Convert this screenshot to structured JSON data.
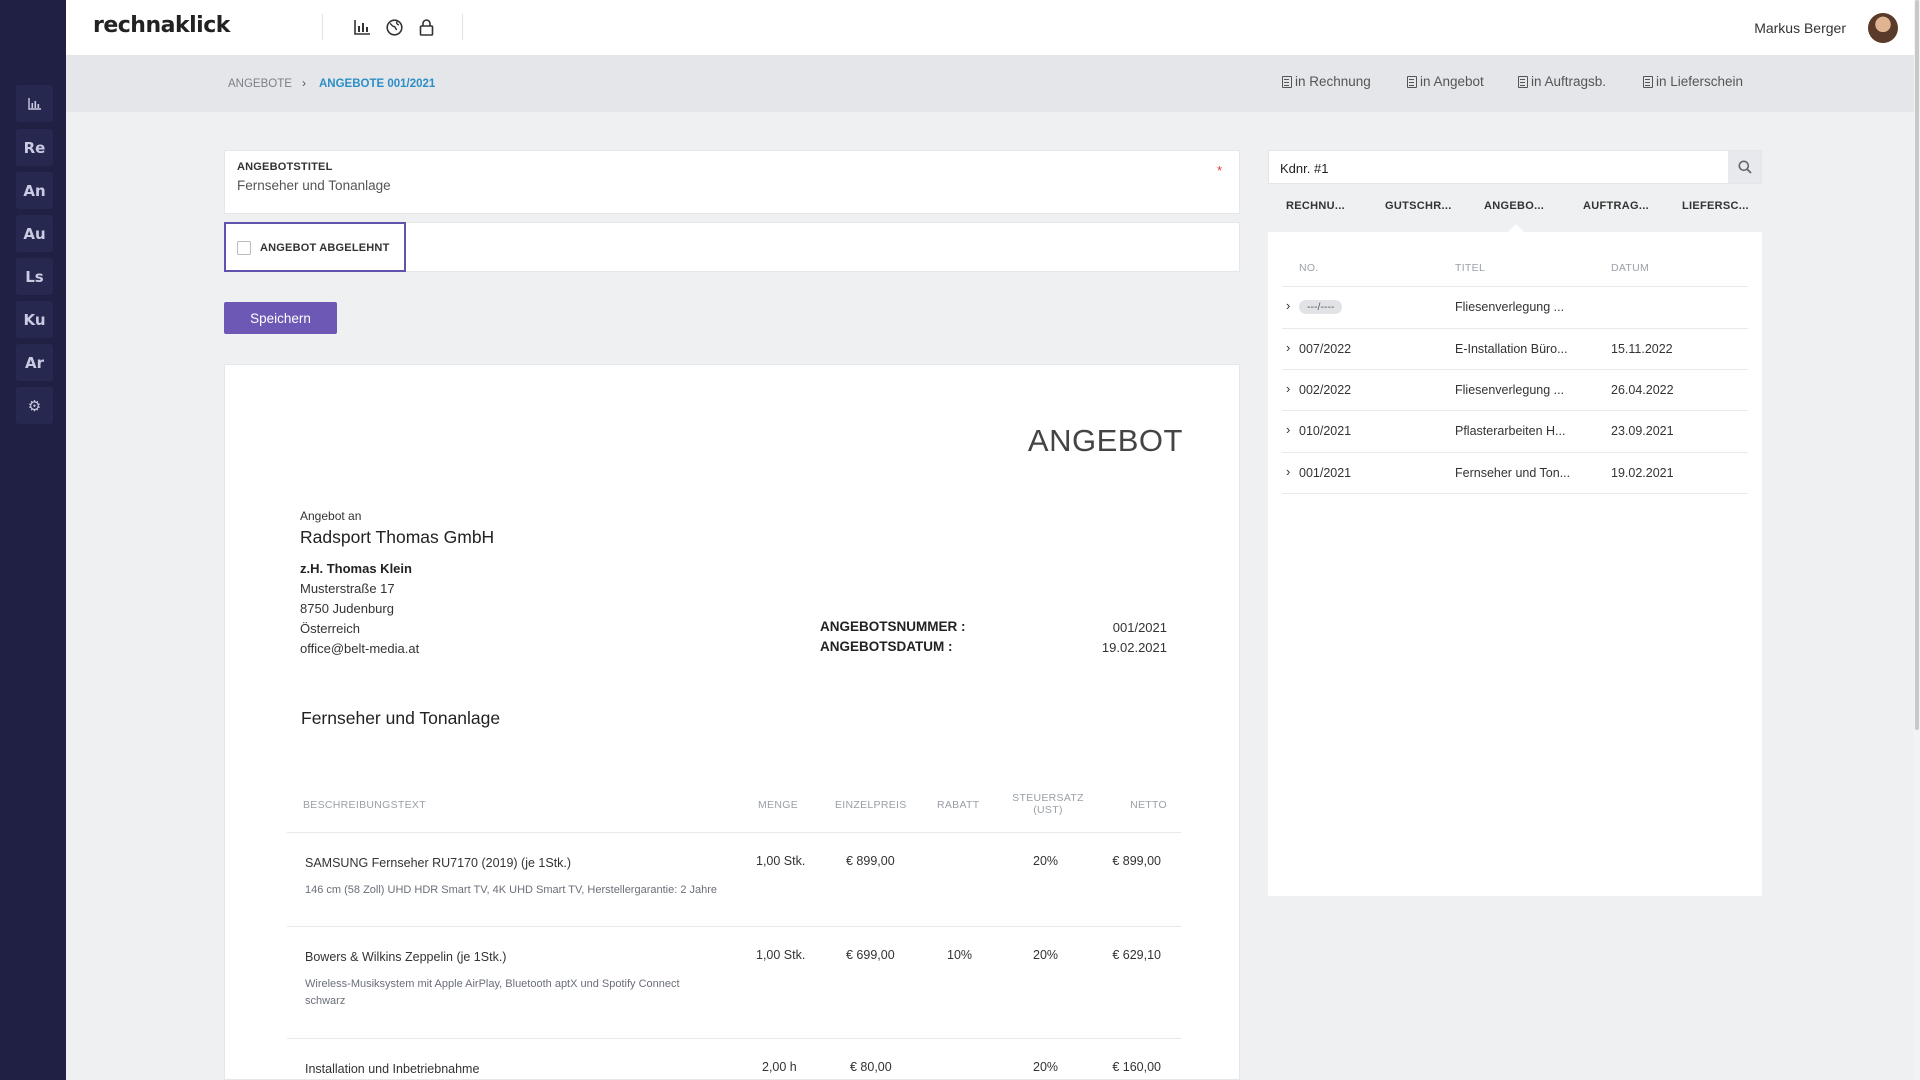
{
  "app": {
    "logo": "rechnaklick",
    "user_name": "Markus Berger"
  },
  "sidebar": {
    "items": [
      {
        "label": "",
        "icon": "bar-chart-icon"
      },
      {
        "label": "Re"
      },
      {
        "label": "An"
      },
      {
        "label": "Au"
      },
      {
        "label": "Ls"
      },
      {
        "label": "Ku"
      },
      {
        "label": "Ar"
      },
      {
        "label": "",
        "icon": "gear-icon"
      }
    ]
  },
  "breadcrumb": {
    "root": "ANGEBOTE",
    "current": "ANGEBOTE 001/2021"
  },
  "actions": {
    "rechnung": "in Rechnung",
    "angebot": "in Angebot",
    "auftrag": "in Auftragsb.",
    "lieferschein": "in Lieferschein"
  },
  "form": {
    "title_label": "ANGEBOTSTITEL",
    "title_value": "Fernseher und Tonanlage",
    "required_mark": "*",
    "declined_label": "ANGEBOT ABGELEHNT",
    "save_label": "Speichern"
  },
  "document": {
    "heading": "ANGEBOT",
    "to_label": "Angebot an",
    "company": "Radsport Thomas GmbH",
    "contact": "z.H. Thomas Klein",
    "street": "Musterstraße 17",
    "city": "8750 Judenburg",
    "country": "Österreich",
    "email": "office@belt-media.at",
    "number_label": "ANGEBOTSNUMMER :",
    "number_value": "001/2021",
    "date_label": "ANGEBOTSDATUM :",
    "date_value": "19.02.2021",
    "subject": "Fernseher und Tonanlage",
    "columns": {
      "desc": "BESCHREIBUNGSTEXT",
      "qty": "MENGE",
      "unit": "EINZELPREIS",
      "discount": "RABATT",
      "tax": "STEUERSATZ",
      "tax_sub": "(UST)",
      "net": "NETTO"
    },
    "items": [
      {
        "title": "SAMSUNG Fernseher RU7170 (2019) (je 1Stk.)",
        "desc1": "146 cm (58 Zoll) UHD HDR Smart TV, 4K UHD Smart TV, Herstellergarantie: 2 Jahre",
        "desc2": "",
        "qty": "1,00 Stk.",
        "unit": "€ 899,00",
        "discount": "",
        "tax": "20%",
        "net": "€ 899,00"
      },
      {
        "title": "Bowers & Wilkins Zeppelin (je 1Stk.)",
        "desc1": "Wireless-Musiksystem mit Apple AirPlay, Bluetooth aptX und Spotify Connect",
        "desc2": "schwarz",
        "qty": "1,00 Stk.",
        "unit": "€ 699,00",
        "discount": "10%",
        "tax": "20%",
        "net": "€ 629,10"
      },
      {
        "title": "Installation und Inbetriebnahme",
        "desc1": "",
        "desc2": "",
        "qty": "2,00 h",
        "unit": "€ 80,00",
        "discount": "",
        "tax": "20%",
        "net": "€ 160,00"
      }
    ]
  },
  "right": {
    "search_value": "Kdnr. #1",
    "tabs": [
      "RECHNU...",
      "GUTSCHR...",
      "ANGEBO...",
      "AUFTRAG...",
      "LIEFERSC..."
    ],
    "active_tab": 2,
    "columns": {
      "no": "NO.",
      "title": "TITEL",
      "date": "DATUM"
    },
    "rows": [
      {
        "no": "---/----",
        "title": "Fliesenverlegung ...",
        "date": "",
        "draft": true
      },
      {
        "no": "007/2022",
        "title": "E-Installation Büro...",
        "date": "15.11.2022"
      },
      {
        "no": "002/2022",
        "title": "Fliesenverlegung ...",
        "date": "26.04.2022"
      },
      {
        "no": "010/2021",
        "title": "Pflasterarbeiten H...",
        "date": "23.09.2021"
      },
      {
        "no": "001/2021",
        "title": "Fernseher und Ton...",
        "date": "19.02.2021"
      }
    ]
  },
  "colors": {
    "sidebar": "#1f2044",
    "accent": "#6d58b5",
    "link": "#2b8fc6"
  }
}
